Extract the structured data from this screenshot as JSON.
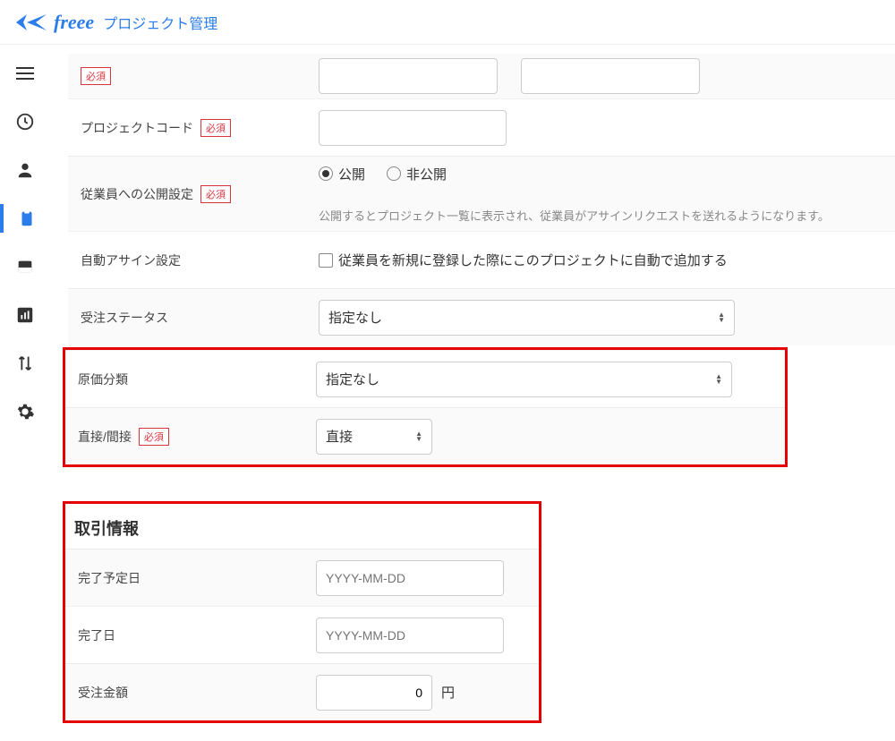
{
  "header": {
    "brand": "freee",
    "app_title": "プロジェクト管理"
  },
  "sidebar": {
    "items": [
      {
        "name": "menu",
        "active": false
      },
      {
        "name": "clock",
        "active": false
      },
      {
        "name": "person",
        "active": false
      },
      {
        "name": "clipboard",
        "active": true
      },
      {
        "name": "monitor",
        "active": false
      },
      {
        "name": "chart",
        "active": false
      },
      {
        "name": "transfer",
        "active": false
      },
      {
        "name": "settings",
        "active": false
      }
    ]
  },
  "required_badge": "必須",
  "form": {
    "project_code": {
      "label": "プロジェクトコード",
      "required": true,
      "value": ""
    },
    "publish": {
      "label": "従業員への公開設定",
      "required": true,
      "options": {
        "public": "公開",
        "private": "非公開"
      },
      "selected": "public",
      "help": "公開するとプロジェクト一覧に表示され、従業員がアサインリクエストを送れるようになります。"
    },
    "auto_assign": {
      "label": "自動アサイン設定",
      "checkbox_label": "従業員を新規に登録した際にこのプロジェクトに自動で追加する",
      "checked": false
    },
    "order_status": {
      "label": "受注ステータス",
      "value": "指定なし"
    },
    "cost_category": {
      "label": "原価分類",
      "value": "指定なし"
    },
    "direct_indirect": {
      "label": "直接/間接",
      "required": true,
      "value": "直接"
    }
  },
  "transaction": {
    "title": "取引情報",
    "scheduled": {
      "label": "完了予定日",
      "placeholder": "YYYY-MM-DD"
    },
    "completed": {
      "label": "完了日",
      "placeholder": "YYYY-MM-DD"
    },
    "amount": {
      "label": "受注金額",
      "value": "0",
      "unit": "円"
    }
  }
}
